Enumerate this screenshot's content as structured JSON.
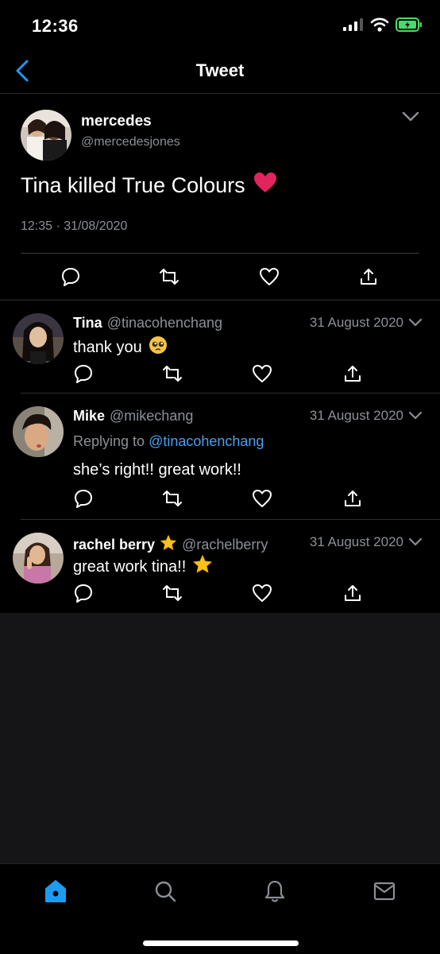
{
  "status": {
    "time": "12:36"
  },
  "nav": {
    "title": "Tweet"
  },
  "main_tweet": {
    "name": "mercedes",
    "handle": "@mercedesjones",
    "text": "Tina killed True Colours",
    "emoji": "❤️",
    "timestamp": "12:35 · 31/08/2020"
  },
  "replies": [
    {
      "name": "Tina",
      "handle": "@tinacohenchang",
      "date": "31 August 2020",
      "text": "thank you",
      "emoji": "🥺"
    },
    {
      "name": "Mike",
      "handle": "@mikechang",
      "date": "31 August 2020",
      "replying_prefix": "Replying to ",
      "replying_to": "@tinacohenchang",
      "text": "she’s right!! great work!!"
    },
    {
      "name": "rachel berry",
      "name_emoji": "⭐",
      "handle": "@rachelberry",
      "date": "31 August 2020",
      "text": "great work tina!!",
      "emoji": "⭐"
    }
  ],
  "colors": {
    "accent": "#1d9bf0",
    "mention": "#4a9ff0",
    "muted": "#8b8f95",
    "heart": "#e0245e",
    "battery": "#4cd964"
  },
  "icons": [
    "back-chevron-icon",
    "chevron-down-icon",
    "reply-icon",
    "retweet-icon",
    "like-icon",
    "share-icon",
    "home-icon",
    "search-icon",
    "notifications-icon",
    "messages-icon"
  ]
}
